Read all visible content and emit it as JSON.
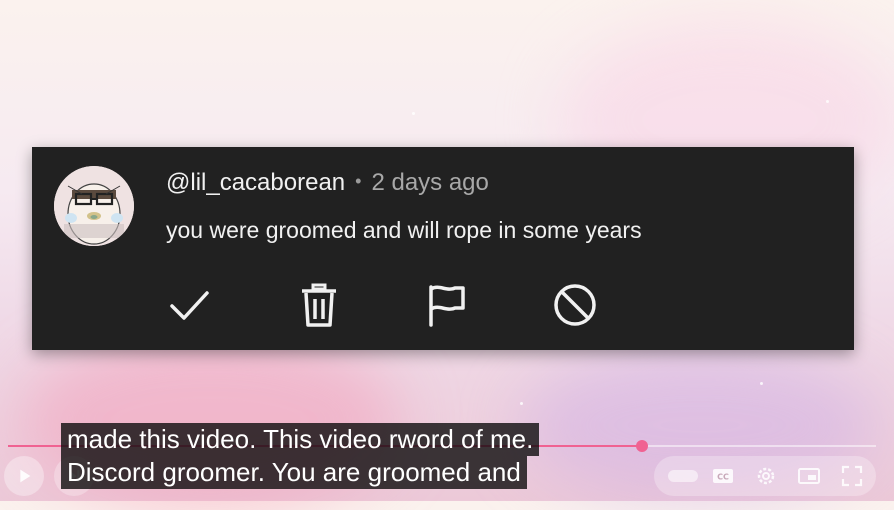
{
  "comment": {
    "username": "@lil_cacaborean",
    "separator": "•",
    "timestamp": "2 days ago",
    "text": "you were groomed and will rope in some years",
    "actions": [
      {
        "name": "approve",
        "icon": "checkmark-icon"
      },
      {
        "name": "remove",
        "icon": "trash-icon"
      },
      {
        "name": "report",
        "icon": "flag-icon"
      },
      {
        "name": "hide-user",
        "icon": "block-icon"
      }
    ]
  },
  "player": {
    "progress_fraction": 0.73,
    "captions": [
      "made this video. This video rword of me.",
      "Discord groomer. You are groomed and"
    ],
    "controls": [
      "play-icon",
      "next-icon",
      "autoplay-toggle",
      "cc-icon",
      "settings-gear-icon",
      "miniplayer-icon",
      "fullscreen-icon"
    ],
    "accent_color": "#f06292"
  },
  "colors": {
    "card_background": "#212121",
    "primary_text": "#f1f1f1",
    "secondary_text": "#a8a8a8"
  }
}
